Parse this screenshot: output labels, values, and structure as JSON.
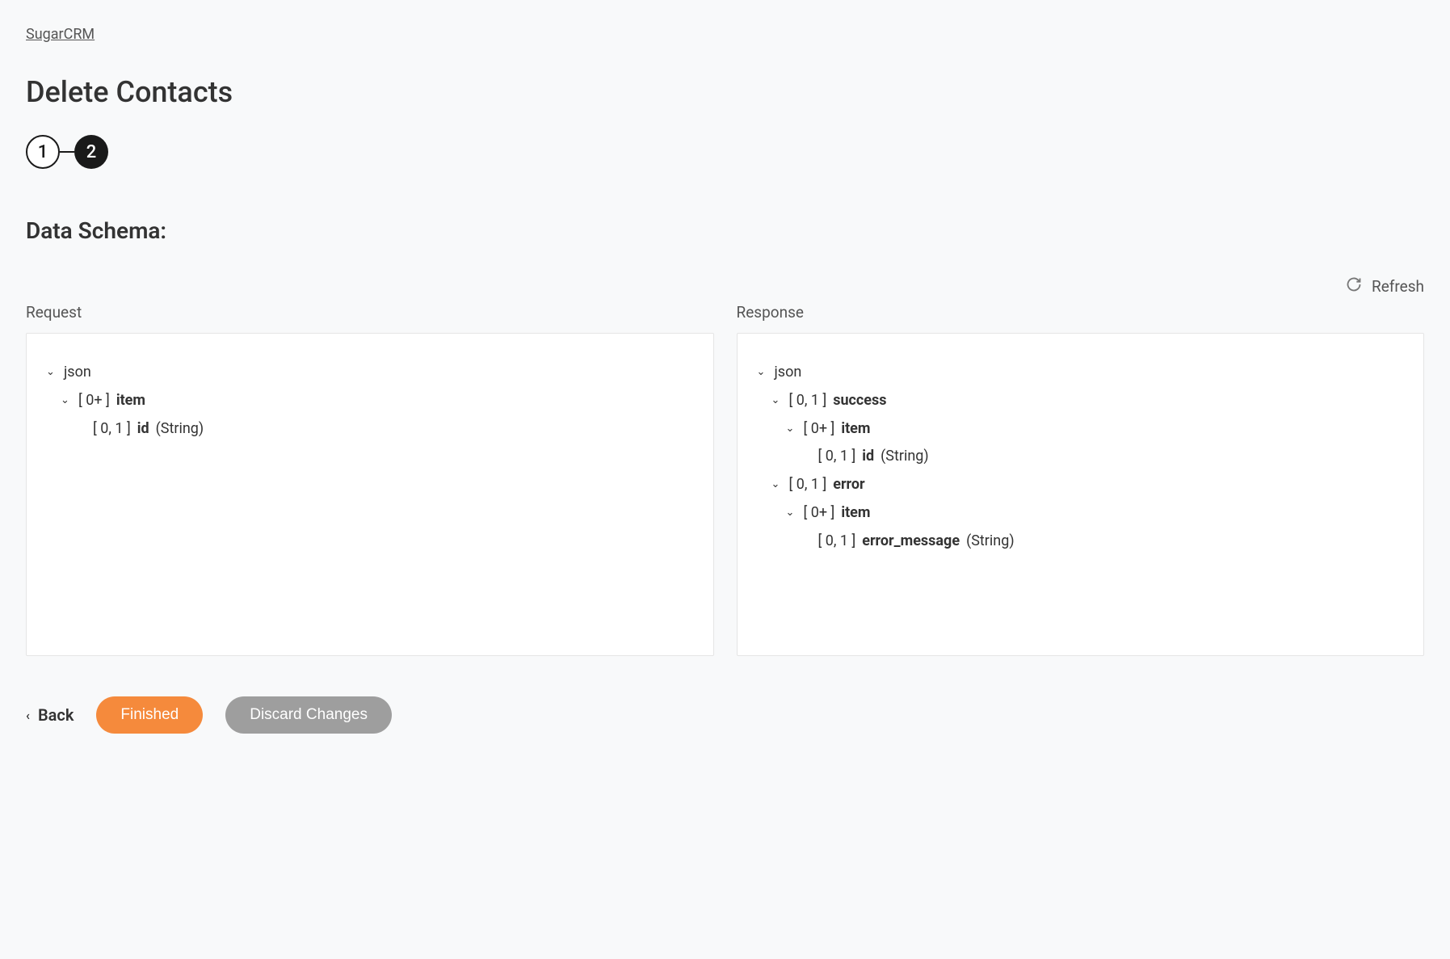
{
  "breadcrumb": "SugarCRM",
  "title": "Delete Contacts",
  "stepper": {
    "step1": "1",
    "step2": "2",
    "active": 2
  },
  "section_header": "Data Schema:",
  "refresh_label": "Refresh",
  "panels": {
    "request_label": "Request",
    "response_label": "Response"
  },
  "request_tree": {
    "root": "json",
    "item": {
      "cardinality": "[ 0+ ]",
      "name": "item"
    },
    "id": {
      "cardinality": "[ 0, 1 ]",
      "name": "id",
      "type": "(String)"
    }
  },
  "response_tree": {
    "root": "json",
    "success": {
      "cardinality": "[ 0, 1 ]",
      "name": "success"
    },
    "success_item": {
      "cardinality": "[ 0+ ]",
      "name": "item"
    },
    "success_id": {
      "cardinality": "[ 0, 1 ]",
      "name": "id",
      "type": "(String)"
    },
    "error": {
      "cardinality": "[ 0, 1 ]",
      "name": "error"
    },
    "error_item": {
      "cardinality": "[ 0+ ]",
      "name": "item"
    },
    "error_msg": {
      "cardinality": "[ 0, 1 ]",
      "name": "error_message",
      "type": "(String)"
    }
  },
  "footer": {
    "back": "Back",
    "finished": "Finished",
    "discard": "Discard Changes"
  }
}
